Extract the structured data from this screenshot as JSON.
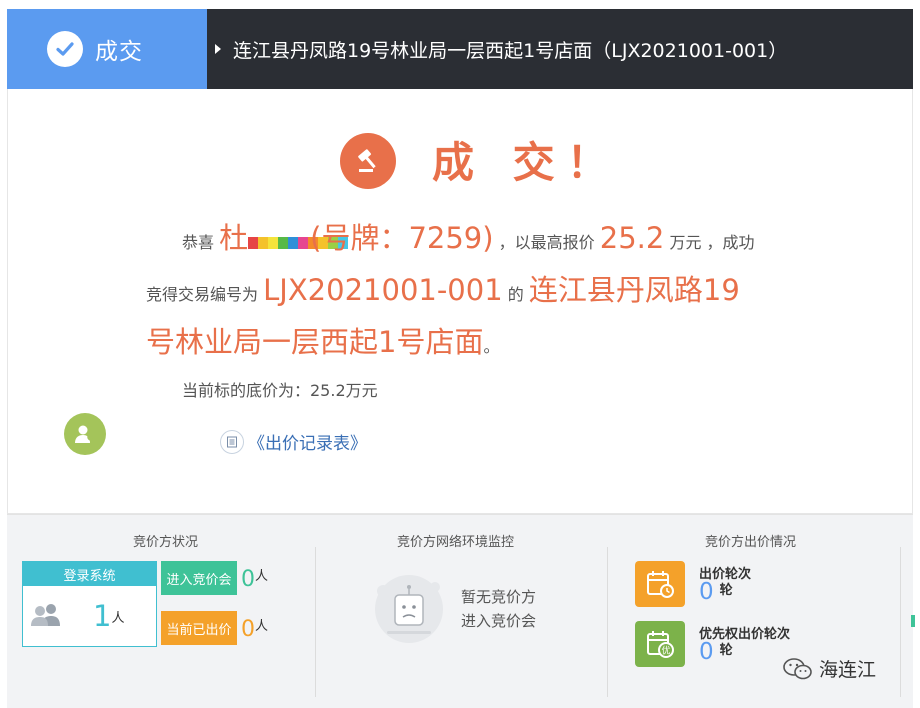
{
  "header": {
    "status_label": "成交",
    "title": "连江县丹凤路19号林业局一层西起1号店面（LJX2021001-001）"
  },
  "result": {
    "headline": "成 交！",
    "congrats": "恭喜",
    "winner_surname": "杜",
    "plate_text": "(号牌：7259)",
    "highest_bid_prefix": "，以最高报价",
    "price": "25.2",
    "price_unit_suffix": "万元 ，成功",
    "won_prefix": "竞得交易编号为",
    "trade_code": "LJX2021001-001",
    "of": "的",
    "item_line1": "连江县丹凤路19",
    "item_line2": "号林业局一层西起1号店面",
    "period": "。",
    "reserve_price": "当前标的底价为：25.2万元",
    "record_link": "《出价记录表》"
  },
  "stats": {
    "bidder_status": {
      "title": "竞价方状况",
      "login_label": "登录系统",
      "login_count": "1",
      "login_unit": "人",
      "entered_label": "进入竞价会",
      "entered_count": "0",
      "entered_unit": "人",
      "bid_label": "当前已出价",
      "bid_count": "0",
      "bid_unit": "人"
    },
    "network": {
      "title": "竞价方网络环境监控",
      "empty_line1": "暂无竞价方",
      "empty_line2": "进入竞价会"
    },
    "bids": {
      "title": "竞价方出价情况",
      "rounds_label": "出价轮次",
      "rounds_count": "0",
      "rounds_unit": "轮",
      "priority_label": "优先权出价轮次",
      "priority_count": "0",
      "priority_unit": "轮",
      "priority_icon_char": "优"
    }
  },
  "watermark": "海连江",
  "colors": {
    "status_blue": "#5b9bf0",
    "title_dark": "#2b2e34",
    "accent_orange": "#e8704a",
    "cyan": "#40bfd0",
    "green": "#3ec398",
    "orange": "#f4a12a",
    "olive_green": "#7cb24a"
  }
}
